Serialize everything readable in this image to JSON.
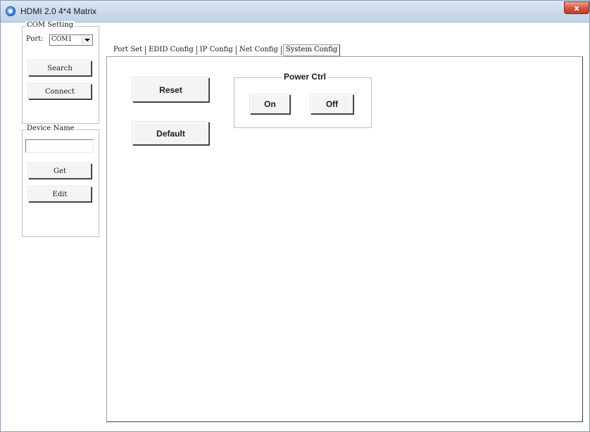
{
  "window": {
    "title": "HDMI 2.0 4*4 Matrix",
    "close_glyph": "x",
    "icon": "app-globe-icon"
  },
  "com_setting": {
    "legend": "COM Setting",
    "port_label": "Port:",
    "port_value": "COM1",
    "search_label": "Search",
    "connect_label": "Connect"
  },
  "device_name": {
    "legend": "Device Name",
    "value": "",
    "get_label": "Get",
    "edit_label": "Edit"
  },
  "tabs": [
    {
      "label": "Port Set",
      "active": false
    },
    {
      "label": "EDID Config",
      "active": false
    },
    {
      "label": "IP Config",
      "active": false
    },
    {
      "label": "Net Config",
      "active": false
    },
    {
      "label": "System Config",
      "active": true
    }
  ],
  "system_config": {
    "reset_label": "Reset",
    "default_label": "Default",
    "power_ctrl": {
      "legend": "Power Ctrl",
      "on_label": "On",
      "off_label": "Off"
    }
  },
  "colors": {
    "titlebar": "#c8d8eb",
    "close_button": "#d2533f",
    "button_face": "#f4f4f4",
    "border": "#c0c0c0"
  }
}
